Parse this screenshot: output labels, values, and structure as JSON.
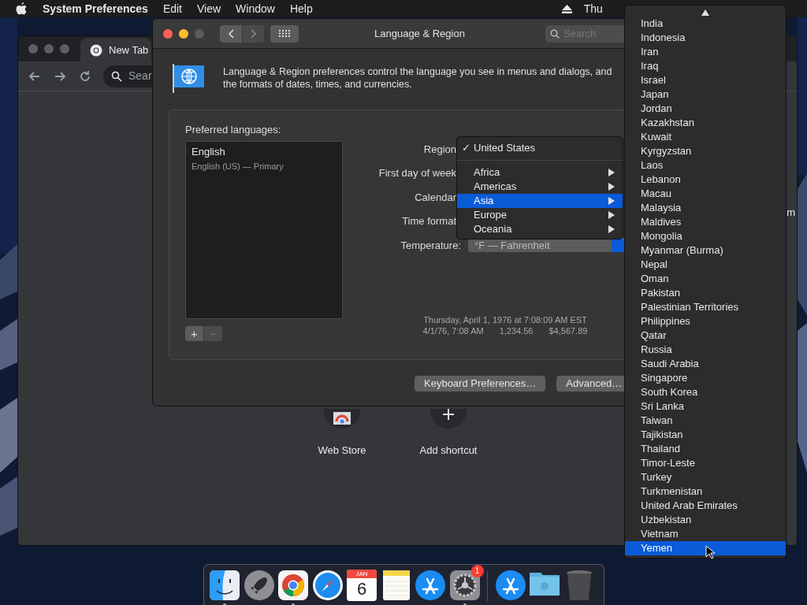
{
  "menu_bar": {
    "app": "System Preferences",
    "items": [
      "Edit",
      "View",
      "Window",
      "Help"
    ],
    "clock": "Thu"
  },
  "browser": {
    "tab": "New Tab",
    "search_placeholder": "Sear",
    "edge_text": "m",
    "shortcuts": [
      {
        "kind": "store",
        "label": "Web Store"
      },
      {
        "kind": "add",
        "label": "Add shortcut"
      }
    ]
  },
  "prefs": {
    "title": "Language & Region",
    "search_placeholder": "Search",
    "description": "Language & Region preferences control the language you see in menus and dialogs, and the formats of dates, times, and currencies.",
    "languages_label": "Preferred languages:",
    "languages": [
      {
        "name": "English",
        "detail": "English (US) — Primary",
        "selected": false
      }
    ],
    "add": "+",
    "remove": "−",
    "fields": [
      {
        "label": "Region"
      },
      {
        "label": "First day of week"
      },
      {
        "label": "Calendar"
      },
      {
        "label": "Time format"
      },
      {
        "label": "Temperature:",
        "value": "°F — Fahrenheit"
      }
    ],
    "sample": {
      "long_date": "Thursday, April 1, 1976 at 7:08:09 AM EST",
      "short_date": "4/1/76, 7:08 AM",
      "number": "1,234.56",
      "currency": "$4,567.89"
    },
    "buttons": [
      "Keyboard Preferences…",
      "Advanced…"
    ]
  },
  "region_menu": {
    "check": "✓",
    "current": "United States",
    "items": [
      {
        "label": "Africa",
        "selected": false
      },
      {
        "label": "Americas",
        "selected": false
      },
      {
        "label": "Asia",
        "selected": true
      },
      {
        "label": "Europe",
        "selected": false
      },
      {
        "label": "Oceania",
        "selected": false
      }
    ]
  },
  "submenu": {
    "items": [
      {
        "label": "India",
        "selected": false
      },
      {
        "label": "Indonesia",
        "selected": false
      },
      {
        "label": "Iran",
        "selected": false
      },
      {
        "label": "Iraq",
        "selected": false
      },
      {
        "label": "Israel",
        "selected": false
      },
      {
        "label": "Japan",
        "selected": false
      },
      {
        "label": "Jordan",
        "selected": false
      },
      {
        "label": "Kazakhstan",
        "selected": false
      },
      {
        "label": "Kuwait",
        "selected": false
      },
      {
        "label": "Kyrgyzstan",
        "selected": false
      },
      {
        "label": "Laos",
        "selected": false
      },
      {
        "label": "Lebanon",
        "selected": false
      },
      {
        "label": "Macau",
        "selected": false
      },
      {
        "label": "Malaysia",
        "selected": false
      },
      {
        "label": "Maldives",
        "selected": false
      },
      {
        "label": "Mongolia",
        "selected": false
      },
      {
        "label": "Myanmar (Burma)",
        "selected": false
      },
      {
        "label": "Nepal",
        "selected": false
      },
      {
        "label": "Oman",
        "selected": false
      },
      {
        "label": "Pakistan",
        "selected": false
      },
      {
        "label": "Palestinian Territories",
        "selected": false
      },
      {
        "label": "Philippines",
        "selected": false
      },
      {
        "label": "Qatar",
        "selected": false
      },
      {
        "label": "Russia",
        "selected": false
      },
      {
        "label": "Saudi Arabia",
        "selected": false
      },
      {
        "label": "Singapore",
        "selected": false
      },
      {
        "label": "South Korea",
        "selected": false
      },
      {
        "label": "Sri Lanka",
        "selected": false
      },
      {
        "label": "Taiwan",
        "selected": false
      },
      {
        "label": "Tajikistan",
        "selected": false
      },
      {
        "label": "Thailand",
        "selected": false
      },
      {
        "label": "Timor-Leste",
        "selected": false
      },
      {
        "label": "Turkey",
        "selected": false
      },
      {
        "label": "Turkmenistan",
        "selected": false
      },
      {
        "label": "United Arab Emirates",
        "selected": false
      },
      {
        "label": "Uzbekistan",
        "selected": false
      },
      {
        "label": "Vietnam",
        "selected": false
      },
      {
        "label": "Yemen",
        "selected": true
      }
    ]
  },
  "dock": {
    "items": [
      {
        "kind": "finder",
        "running": true
      },
      {
        "kind": "launchpad",
        "running": false
      },
      {
        "kind": "chrome",
        "running": true
      },
      {
        "kind": "safari",
        "running": false
      },
      {
        "kind": "calendar",
        "running": false,
        "month": "JAN",
        "day": "6"
      },
      {
        "kind": "notes",
        "running": false
      },
      {
        "kind": "appstore",
        "running": false
      },
      {
        "kind": "settings",
        "running": true,
        "badge": "1"
      },
      {
        "kind": "divider"
      },
      {
        "kind": "appstore",
        "running": false
      },
      {
        "kind": "folder",
        "running": false
      },
      {
        "kind": "trash",
        "running": false
      }
    ]
  }
}
